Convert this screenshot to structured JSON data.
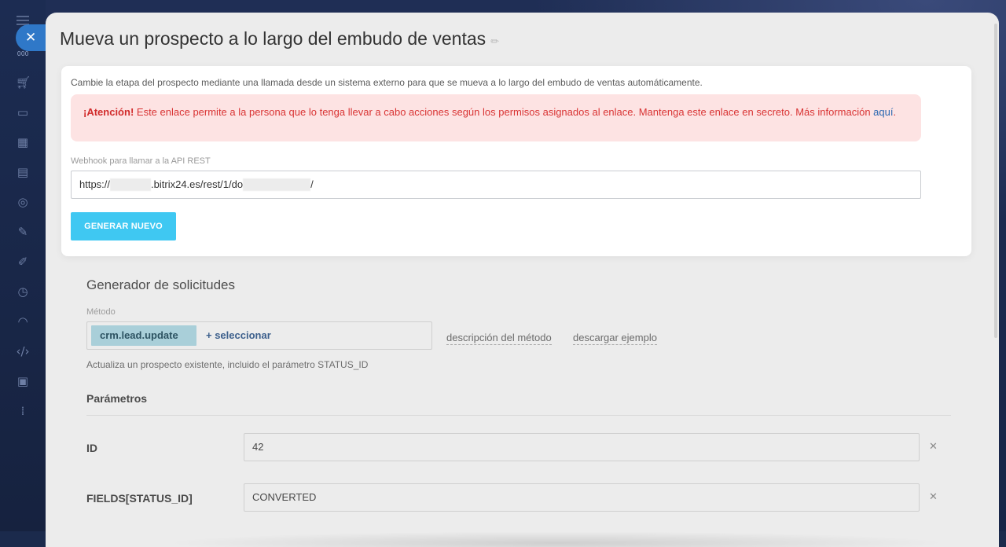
{
  "panel": {
    "title": "Mueva un prospecto a lo largo del embudo de ventas"
  },
  "sidebar": {
    "tiny_label": "000",
    "icons": [
      "cart-icon",
      "chat-icon",
      "calendar-icon",
      "drive-icon",
      "target-icon",
      "edit-icon",
      "pen-icon",
      "clock-icon",
      "speed-icon",
      "code-icon",
      "grid-icon",
      "apps-icon"
    ]
  },
  "webhook_card": {
    "description": "Cambie la etapa del prospecto mediante una llamada desde un sistema externo para que se mueva a lo largo del embudo de ventas automáticamente.",
    "alert_bold": "¡Atención!",
    "alert_text": " Este enlace permite a la persona que lo tenga llevar a cabo acciones según los permisos asignados al enlace. Mantenga este enlace en secreto. Más información ",
    "alert_link": "aquí",
    "alert_end": ".",
    "webhook_label": "Webhook para llamar a la API REST",
    "url_prefix": "https://",
    "url_middle": ".bitrix24.es/rest/1/do",
    "url_suffix": "/",
    "generate_button": "GENERAR NUEVO"
  },
  "generator": {
    "title": "Generador de solicitudes",
    "method_label": "Método",
    "method_value": "crm.lead.update",
    "select_label": "+ seleccionar",
    "method_description_link": "descripción del método",
    "download_example_link": "descargar ejemplo",
    "method_help": "Actualiza un prospecto existente, incluido el parámetro STATUS_ID",
    "params_title": "Parámetros",
    "params": [
      {
        "name": "ID",
        "value": "42"
      },
      {
        "name": "FIELDS[STATUS_ID]",
        "value": "CONVERTED"
      }
    ]
  }
}
